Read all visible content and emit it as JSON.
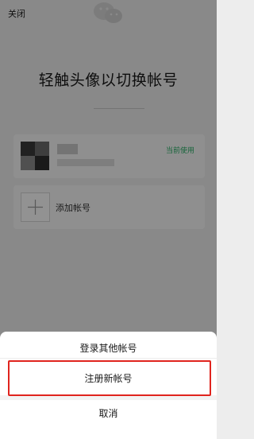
{
  "header": {
    "close_label": "关闭",
    "logo_icon": "wechat-logo-icon"
  },
  "main": {
    "title": "轻触头像以切换帐号",
    "accounts": [
      {
        "status_badge": "当前使用",
        "avatar_icon": "avatar-icon"
      }
    ],
    "add_account": {
      "label": "添加帐号",
      "icon": "plus-icon"
    }
  },
  "sheet": {
    "login_other": "登录其他帐号",
    "register_new": "注册新帐号",
    "cancel": "取消"
  },
  "colors": {
    "accent_green": "#2aae67",
    "highlight_red": "#e0241e",
    "overlay": "rgba(0,0,0,0.42)"
  }
}
